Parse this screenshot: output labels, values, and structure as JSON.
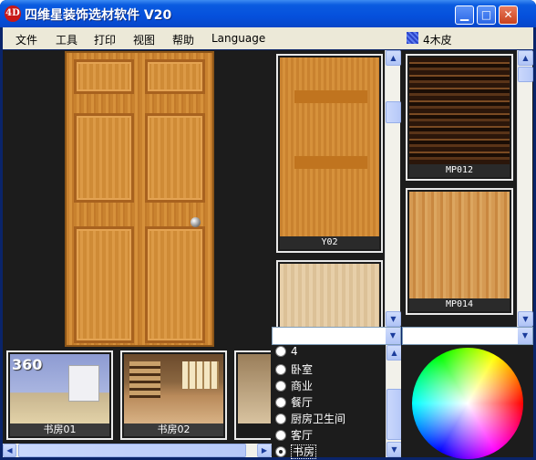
{
  "window": {
    "title": "四维星装饰选材软件 V20",
    "icon_text": "4D",
    "minimize_label": "▁",
    "maximize_label": "□",
    "close_label": "✕"
  },
  "menu": {
    "items": [
      "文件",
      "工具",
      "打印",
      "视图",
      "帮助",
      "Language"
    ],
    "material_category": "4木皮"
  },
  "materials": [
    {
      "label": "Y02",
      "kind": "door"
    },
    {
      "label": "MP012",
      "kind": "veneer-dark"
    },
    {
      "label": "MP014",
      "kind": "veneer-light"
    }
  ],
  "scenes": [
    {
      "label": "书房01",
      "badge": "360"
    },
    {
      "label": "书房02"
    }
  ],
  "rooms": {
    "items": [
      "4",
      "卧室",
      "商业",
      "餐厅",
      "厨房卫生间",
      "客厅",
      "书房"
    ],
    "selected": "书房"
  },
  "colors": {
    "titlebar": "#0550dc",
    "wood": "#d6913b",
    "panel_bg": "#1c1c1c",
    "menu_bg": "#ece9d8"
  },
  "icons": {
    "scroll_up": "▲",
    "scroll_down": "▼",
    "scroll_left": "◀",
    "scroll_right": "▶",
    "dropdown": "▼"
  }
}
